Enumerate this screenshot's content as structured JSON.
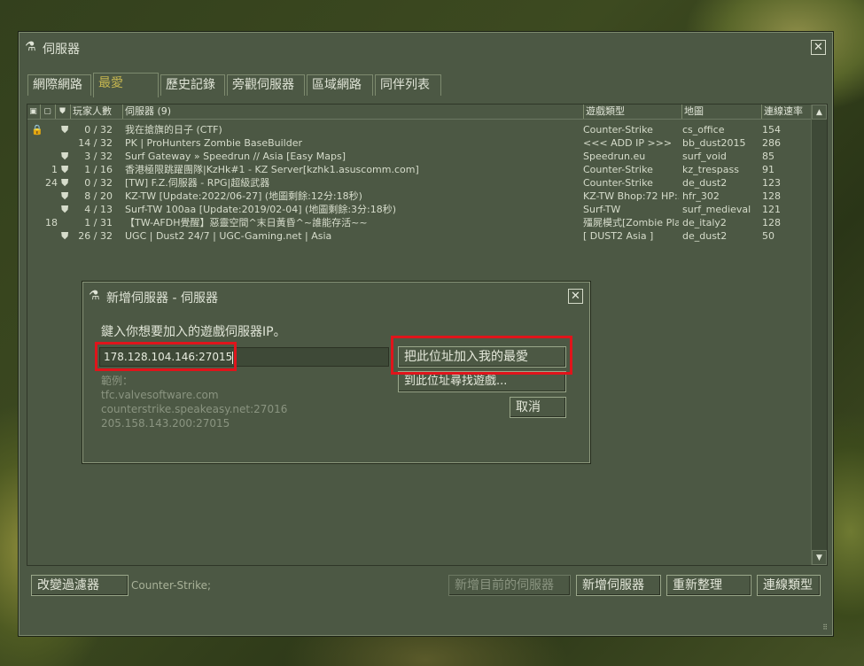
{
  "window": {
    "title": "伺服器",
    "close_glyph": "✕",
    "app_icon": "steam-icon"
  },
  "tabs": [
    {
      "label": "網際網路"
    },
    {
      "label": "最愛",
      "active": true
    },
    {
      "label": "歷史記錄"
    },
    {
      "label": "旁觀伺服器"
    },
    {
      "label": "區域網路"
    },
    {
      "label": "同伴列表"
    }
  ],
  "table": {
    "header_icons": [
      "lock-icon",
      "vac-icon",
      "shield-icon"
    ],
    "columns": {
      "players": "玩家人數",
      "servers": "伺服器 (9)",
      "game": "遊戲類型",
      "map": "地圖",
      "latency": "連線速率"
    },
    "rows": [
      {
        "lock": "🔒",
        "bots": "",
        "secure": "⛊",
        "players": "0 / 32",
        "name": "我在搶旗的日子 (CTF)",
        "game": "Counter-Strike",
        "map": "cs_office",
        "latency": "154"
      },
      {
        "lock": "",
        "bots": "",
        "secure": "",
        "players": "14 / 32",
        "name": "PK | ProHunters Zombie BaseBuilder",
        "game": "<<< ADD IP >>>",
        "map": "bb_dust2015",
        "latency": "286"
      },
      {
        "lock": "",
        "bots": "",
        "secure": "⛊",
        "players": "3 / 32",
        "name": "Surf Gateway » Speedrun // Asia [Easy Maps]",
        "game": "Speedrun.eu",
        "map": "surf_void",
        "latency": "85"
      },
      {
        "lock": "",
        "bots": "1",
        "secure": "⛊",
        "players": "1 / 16",
        "name": "香港極限跳躍團隊|KzHk#1 - KZ Server[kzhk1.asuscomm.com]",
        "game": "Counter-Strike",
        "map": "kz_trespass",
        "latency": "91"
      },
      {
        "lock": "",
        "bots": "24",
        "secure": "⛊",
        "players": "0 / 32",
        "name": "[TW] F.Z.伺服器 - RPG|超級武器",
        "game": "Counter-Strike",
        "map": "de_dust2",
        "latency": "123"
      },
      {
        "lock": "",
        "bots": "",
        "secure": "⛊",
        "players": "8 / 20",
        "name": "KZ-TW [Update:2022/06-27] (地圖剩餘:12分:18秒)",
        "game": "KZ-TW Bhop:72 HP:...",
        "map": "hfr_302",
        "latency": "128"
      },
      {
        "lock": "",
        "bots": "",
        "secure": "⛊",
        "players": "4 / 13",
        "name": "Surf-TW 100aa [Update:2019/02-04] (地圖剩餘:3分:18秒)",
        "game": "Surf-TW",
        "map": "surf_medieval",
        "latency": "121"
      },
      {
        "lock": "",
        "bots": "18",
        "secure": "",
        "players": "1 / 31",
        "name": "【TW-AFDH覺醒】惡靈空間^末日黃昏^~誰能存活~~",
        "game": "殭屍模式[Zombie Pla...",
        "map": "de_italy2",
        "latency": "128"
      },
      {
        "lock": "",
        "bots": "",
        "secure": "⛊",
        "players": "26 / 32",
        "name": "UGC | Dust2 24/7 | UGC-Gaming.net | Asia",
        "game": "[ DUST2 Asia ]",
        "map": "de_dust2",
        "latency": "50"
      }
    ]
  },
  "scrollbar": {
    "up": "▲",
    "down": "▼"
  },
  "bottom": {
    "change_filter": "改變過濾器",
    "filter_text": "Counter-Strike;",
    "add_current": "新增目前的伺服器",
    "add_server": "新增伺服器",
    "refresh": "重新整理",
    "connection_type": "連線類型",
    "grip": "⠿"
  },
  "dialog": {
    "title": "新增伺服器 - 伺服器",
    "close_glyph": "✕",
    "prompt": "鍵入你想要加入的遊戲伺服器IP。",
    "ip_value": "178.128.104.146:27015",
    "add_favorite": "把此位址加入我的最愛",
    "find_games": "到此位址尋找遊戲...",
    "cancel": "取消",
    "examples_label": "範例：",
    "examples": [
      "tfc.valvesoftware.com",
      "counterstrike.speakeasy.net:27016",
      "205.158.143.200:27015"
    ]
  },
  "highlight_color": "#e0141b"
}
